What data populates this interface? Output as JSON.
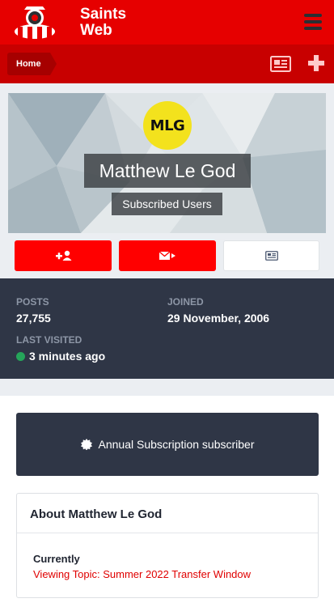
{
  "header": {
    "brand_line1": "Saints",
    "brand_line2": "Web",
    "menu_icon": "hamburger-icon"
  },
  "subnav": {
    "breadcrumb_home": "Home",
    "icons": [
      "newspaper-icon",
      "plus-icon"
    ]
  },
  "profile": {
    "avatar_text": "MLG",
    "name": "Matthew Le God",
    "group": "Subscribed Users",
    "actions": [
      "add-follow-icon",
      "message-icon",
      "content-icon"
    ]
  },
  "stats": {
    "posts_label": "POSTS",
    "posts_value": "27,755",
    "joined_label": "JOINED",
    "joined_value": "29 November, 2006",
    "last_visited_label": "LAST VISITED",
    "last_visited_value": "3 minutes ago"
  },
  "subscription": {
    "text": "Annual Subscription subscriber"
  },
  "about": {
    "title": "About Matthew Le God",
    "currently_label": "Currently",
    "currently_value": "Viewing Topic: Summer 2022 Transfer Window"
  },
  "colors": {
    "brand_red": "#e60000",
    "subnav_red": "#c80000",
    "button_red": "#ff0000",
    "dark_panel": "#2f3646",
    "online_green": "#25a55a"
  }
}
